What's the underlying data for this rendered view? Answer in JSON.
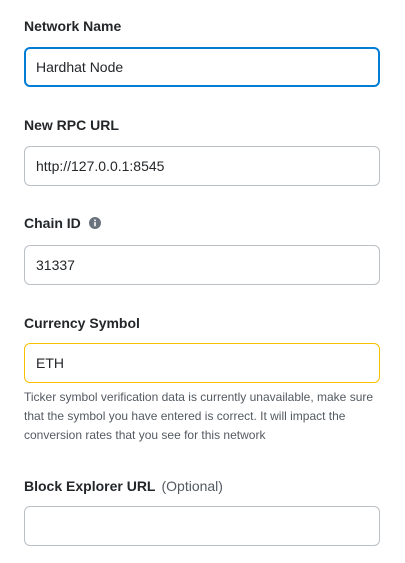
{
  "network_name": {
    "label": "Network Name",
    "value": "Hardhat Node"
  },
  "rpc_url": {
    "label": "New RPC URL",
    "value": "http://127.0.0.1:8545"
  },
  "chain_id": {
    "label": "Chain ID",
    "info_icon": "info-circle-icon",
    "value": "31337"
  },
  "currency_symbol": {
    "label": "Currency Symbol",
    "value": "ETH",
    "warning": "Ticker symbol verification data is currently unavailable, make sure that the symbol you have entered is correct. It will impact the conversion rates that you see for this network"
  },
  "block_explorer": {
    "label": "Block Explorer URL",
    "optional": "(Optional)",
    "value": ""
  },
  "colors": {
    "focus_border": "#037dd6",
    "warning_border": "#f8c000",
    "default_border": "#bbc0c5",
    "text": "#24272a",
    "muted_text": "#535a61"
  }
}
